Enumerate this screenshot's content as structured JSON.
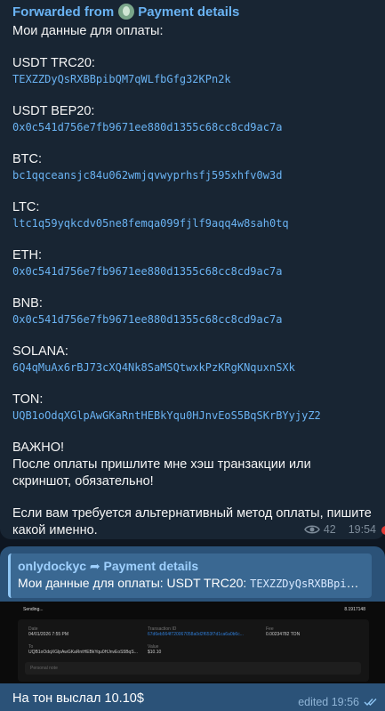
{
  "post": {
    "forwarded_prefix": "Forwarded from",
    "channel_name": "Payment details",
    "intro": "Мои данные для оплаты:",
    "entries": [
      {
        "label": "USDT TRC20:",
        "address": "TEXZZDyQsRXBBpibQM7qWLfbGfg32KPn2k"
      },
      {
        "label": "USDT BEP20:",
        "address": "0x0c541d756e7fb9671ee880d1355c68cc8cd9ac7a"
      },
      {
        "label": "BTC:",
        "address": "bc1qqceansjc84u062wmjqvwyprhsfj595xhfv0w3d"
      },
      {
        "label": "LTC:",
        "address": "ltc1q59yqkcdv05ne8femqa099fjlf9aqq4w8sah0tq"
      },
      {
        "label": "ETH:",
        "address": "0x0c541d756e7fb9671ee880d1355c68cc8cd9ac7a"
      },
      {
        "label": "BNB:",
        "address": "0x0c541d756e7fb9671ee880d1355c68cc8cd9ac7a"
      },
      {
        "label": "SOLANA:",
        "address": "6Q4qMuAx6rBJ73cXQ4Nk8SaMSQtwxkPzKRgKNquxnSXk"
      },
      {
        "label": "TON:",
        "address": "UQB1oOdqXGlpAwGKaRntHEBkYqu0HJnvEoS5BqSKrBYyjyZ2"
      }
    ],
    "important": "ВАЖНО!",
    "note1": "После оплаты пришлите мне хэш транзакции или скриншот, обязательно!",
    "note2": "Если вам требуется альтернативный метод оплаты, пишите какой именно.",
    "views": "42",
    "time": "19:54"
  },
  "reply_message": {
    "quote_author": "onlydockyc",
    "quote_arrow": "➦",
    "quote_source": "Payment details",
    "quote_text": "Мои данные для оплаты:  USDT TRC20: ",
    "quote_mono": "TEXZZDyQsRXBBpibQM...",
    "screenshot": {
      "title": "Sending...",
      "amount": "8.1917148",
      "date_label": "Date",
      "date_value": "04/01/2026 7:55 PM",
      "txid_label": "Transaction ID",
      "txid_value": "67d6eb564f720067058a0d2f653f7d1ca6a0b6c...",
      "fee_label": "Fee",
      "fee_value": "0.00234782 TON",
      "to_label": "To",
      "to_value": "UQB1oOdqXGlpAwGKaRntHEBkYqu0HJnvEoS5BqS...",
      "value_label": "Value",
      "value_value": "$10.10",
      "note_placeholder": "Personal note"
    },
    "text": "На тон выслал 10.10$",
    "edited_time": "edited 19:56"
  },
  "colors": {
    "background": "#0e1621",
    "incoming_bubble": "#182533",
    "outgoing_bubble": "#2b5278",
    "link": "#6ab3f3"
  }
}
